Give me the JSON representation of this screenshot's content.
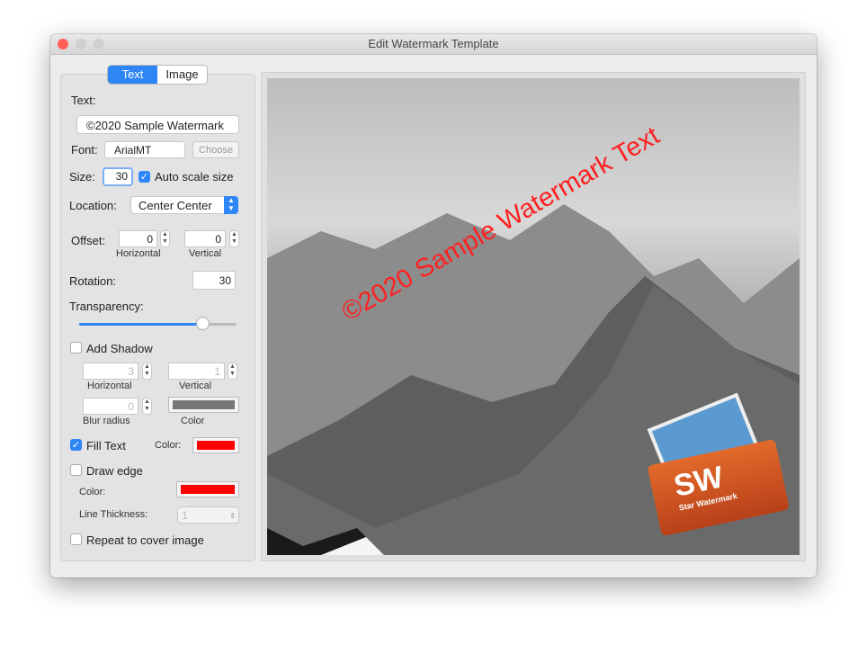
{
  "window": {
    "title": "Edit Watermark Template"
  },
  "tabs": [
    {
      "label": "Text",
      "selected": true
    },
    {
      "label": "Image",
      "selected": false
    }
  ],
  "text_label": "Text:",
  "text_value": "©2020 Sample Watermark",
  "font_label": "Font:",
  "font_value": "ArialMT",
  "choose_label": "Choose",
  "size_label": "Size:",
  "size_value": "30",
  "auto_scale": {
    "label": "Auto scale size",
    "checked": true
  },
  "location_label": "Location:",
  "location_value": "Center Center",
  "offset": {
    "label": "Offset:",
    "horizontal": "0",
    "vertical": "0",
    "h_label": "Horizontal",
    "v_label": "Vertical"
  },
  "rotation_label": "Rotation:",
  "rotation_value": "30",
  "transparency": {
    "label": "Transparency:",
    "value_percent": 78
  },
  "shadow": {
    "label": "Add Shadow",
    "checked": false,
    "horizontal": "3",
    "vertical": "1",
    "blur": "0",
    "h_label": "Horizontal",
    "v_label": "Vertical",
    "blur_label": "Blur radius",
    "color_label": "Color",
    "color": "#777777"
  },
  "fill": {
    "label": "Fill Text",
    "checked": true,
    "color_label": "Color:",
    "color": "#ff0000"
  },
  "edge": {
    "label": "Draw edge",
    "checked": false,
    "color_label": "Color:",
    "color": "#ff0000",
    "thickness_label": "Line Thickness:",
    "thickness": "1"
  },
  "repeat": {
    "label": "Repeat to cover image",
    "checked": false
  },
  "preview": {
    "watermark_text": "©2020 Sample Watermark Text",
    "logo_text": "SW",
    "logo_sub": "Star Watermark"
  },
  "colors": {
    "accent": "#2e86f6",
    "watermark": "#ff2020"
  }
}
